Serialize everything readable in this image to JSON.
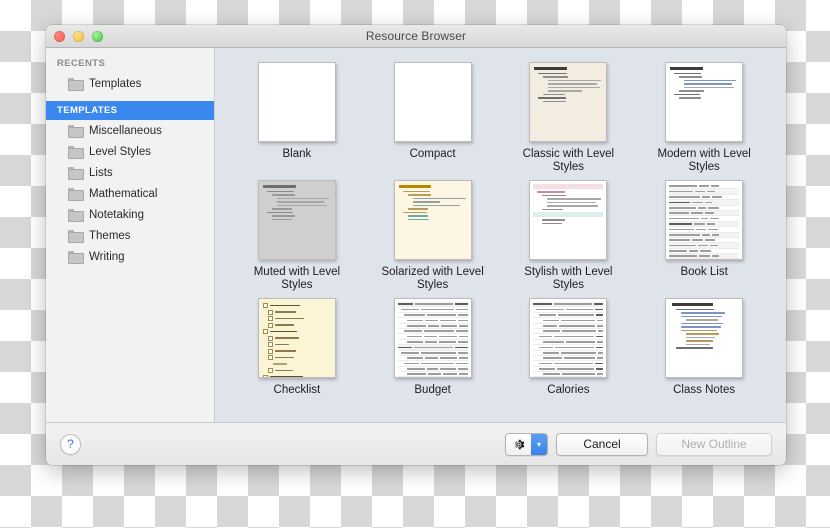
{
  "window": {
    "title": "Resource Browser",
    "traffic_lights": [
      "close",
      "minimize",
      "zoom"
    ]
  },
  "sidebar": {
    "sections": [
      {
        "header": "RECENTS",
        "selected": false,
        "items": [
          {
            "label": "Templates",
            "icon": "folder-icon"
          }
        ]
      },
      {
        "header": "TEMPLATES",
        "selected": true,
        "items": [
          {
            "label": "Miscellaneous",
            "icon": "folder-icon"
          },
          {
            "label": "Level Styles",
            "icon": "folder-icon"
          },
          {
            "label": "Lists",
            "icon": "folder-icon"
          },
          {
            "label": "Mathematical",
            "icon": "folder-icon"
          },
          {
            "label": "Notetaking",
            "icon": "folder-icon"
          },
          {
            "label": "Themes",
            "icon": "folder-icon"
          },
          {
            "label": "Writing",
            "icon": "folder-icon"
          }
        ]
      }
    ],
    "selected_highlight_color": "#3b87f0"
  },
  "content": {
    "background_color": "#dfe3ea",
    "templates": [
      {
        "label": "Blank",
        "style": "blank",
        "bg": "#ffffff"
      },
      {
        "label": "Compact",
        "style": "blank",
        "bg": "#ffffff"
      },
      {
        "label": "Classic with Level Styles",
        "style": "outline",
        "bg": "#f3ece0"
      },
      {
        "label": "Modern with Level Styles",
        "style": "outline",
        "bg": "#ffffff"
      },
      {
        "label": "Muted with Level Styles",
        "style": "outline",
        "bg": "#cfcfcf"
      },
      {
        "label": "Solarized with Level Styles",
        "style": "outline",
        "bg": "#fdf6e3"
      },
      {
        "label": "Stylish with Level Styles",
        "style": "banded",
        "bg": "#ffffff"
      },
      {
        "label": "Book List",
        "style": "table",
        "bg": "#ffffff"
      },
      {
        "label": "Checklist",
        "style": "checklist",
        "bg": "#fbf5d5"
      },
      {
        "label": "Budget",
        "style": "table",
        "bg": "#ffffff"
      },
      {
        "label": "Calories",
        "style": "table",
        "bg": "#ffffff"
      },
      {
        "label": "Class Notes",
        "style": "outline",
        "bg": "#ffffff"
      }
    ]
  },
  "bottombar": {
    "help_label": "?",
    "gear_icon": "gear-icon",
    "gear_chevron_icon": "chevron-down-icon",
    "cancel_label": "Cancel",
    "confirm_label": "New Outline",
    "confirm_disabled": true,
    "accent_color": "#3b82e8"
  }
}
